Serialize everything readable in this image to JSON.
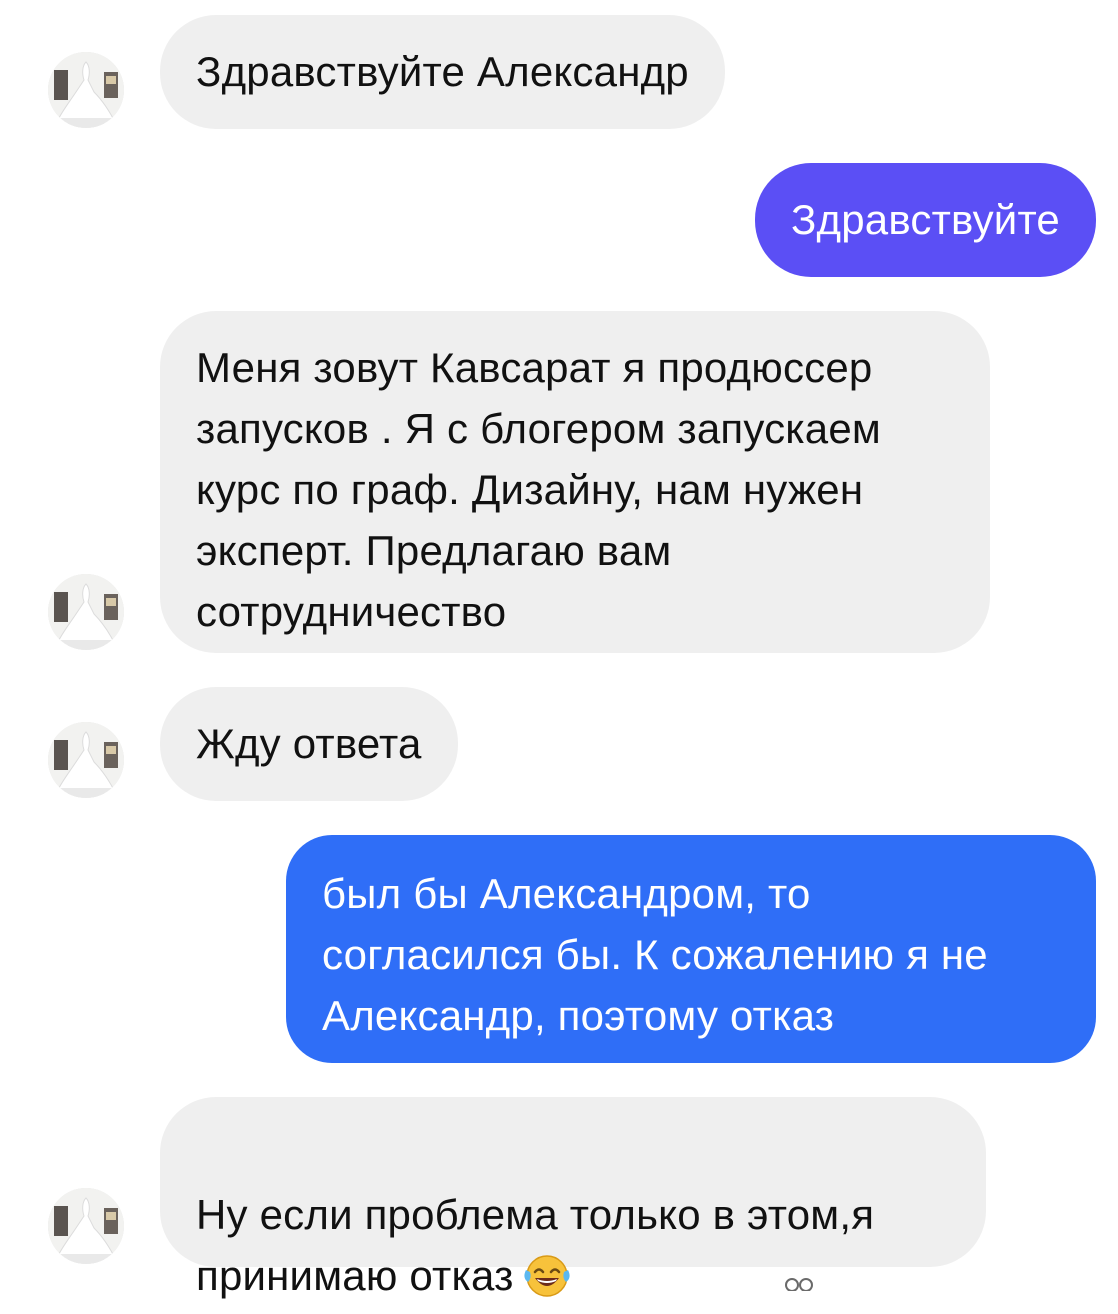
{
  "conversation": {
    "messages": [
      {
        "direction": "incoming",
        "text": "Здравствуйте Александр"
      },
      {
        "direction": "outgoing",
        "text": "Здравствуйте",
        "color": "#5b4ff5"
      },
      {
        "direction": "incoming",
        "text": "Меня зовут Кавсарат я продюссер\nзапусков . Я с блогером запускаем\nкурс по граф. Дизайну, нам нужен\nэксперт. Предлагаю вам\nсотрудничество"
      },
      {
        "direction": "incoming",
        "text": "Жду ответа"
      },
      {
        "direction": "outgoing",
        "text": "был бы Александром, то\nсогласился бы. К сожалению я не\nАлександр, поэтому отказ",
        "color": "#2f6ef7"
      },
      {
        "direction": "incoming",
        "text": "Ну если проблема только в этом,я\nпринимаю отказ",
        "emoji": "face-with-tears-of-joy-icon"
      }
    ]
  },
  "colors": {
    "incoming_bubble": "#efefef",
    "incoming_text": "#111111",
    "outgoing_text": "#ffffff",
    "outgoing_purple": "#5b4ff5",
    "outgoing_blue": "#2f6ef7"
  }
}
